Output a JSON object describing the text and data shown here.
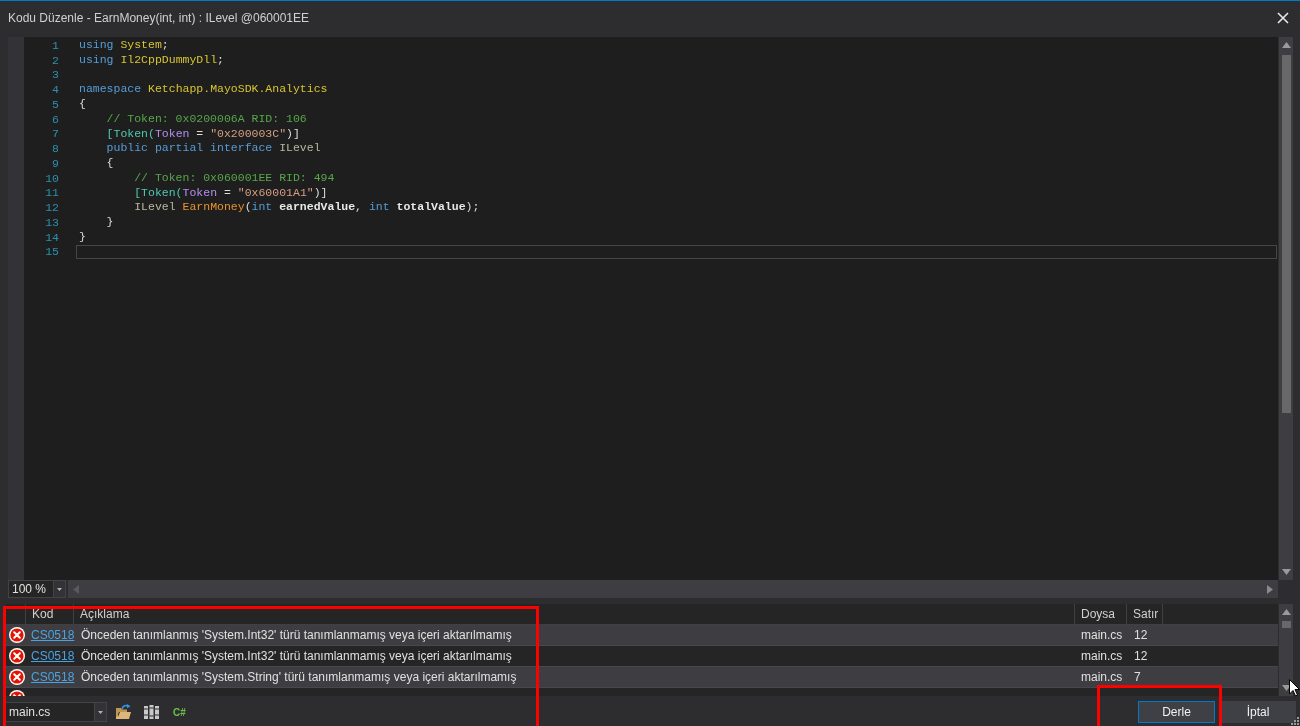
{
  "window": {
    "title": "Kodu Düzenle - EarnMoney(int, int) : ILevel @060001EE"
  },
  "editor": {
    "zoom": "100 %",
    "lines": [
      {
        "number": "1",
        "current": false,
        "tokens": [
          {
            "kind": "keyword",
            "text": "using"
          },
          {
            "kind": "namespace",
            "text": " System"
          },
          {
            "kind": "plain",
            "text": ";"
          }
        ]
      },
      {
        "number": "2",
        "current": false,
        "tokens": [
          {
            "kind": "keyword",
            "text": "using"
          },
          {
            "kind": "namespace",
            "text": " Il2CppDummyDll"
          },
          {
            "kind": "plain",
            "text": ";"
          }
        ]
      },
      {
        "number": "3",
        "current": false
      },
      {
        "number": "4",
        "current": false,
        "tokens": [
          {
            "kind": "keyword",
            "text": "namespace"
          },
          {
            "kind": "namespace",
            "text": " Ketchapp.MayoSDK.Analytics"
          }
        ]
      },
      {
        "number": "5",
        "current": false,
        "tokens": [
          {
            "kind": "plain",
            "text": "{"
          }
        ]
      },
      {
        "number": "6",
        "current": false,
        "tokens": [
          {
            "kind": "comment",
            "text": "    // Token: 0x0200006A RID: 106"
          }
        ]
      },
      {
        "number": "7",
        "current": false,
        "tokens": [
          {
            "kind": "attribute",
            "text": "    [Token("
          },
          {
            "kind": "property",
            "text": "Token"
          },
          {
            "kind": "plain",
            "text": " = "
          },
          {
            "kind": "string",
            "text": "\"0x200003C\""
          },
          {
            "kind": "plain",
            "text": ")]"
          }
        ]
      },
      {
        "number": "8",
        "current": false,
        "tokens": [
          {
            "kind": "keyword",
            "text": "    public partial interface"
          },
          {
            "kind": "type",
            "text": " ILevel"
          }
        ]
      },
      {
        "number": "9",
        "current": false,
        "tokens": [
          {
            "kind": "plain",
            "text": "    {"
          }
        ]
      },
      {
        "number": "10",
        "current": false,
        "tokens": [
          {
            "kind": "comment",
            "text": "        // Token: 0x060001EE RID: 494"
          }
        ]
      },
      {
        "number": "11",
        "current": false,
        "tokens": [
          {
            "kind": "attribute",
            "text": "        [Token("
          },
          {
            "kind": "property",
            "text": "Token"
          },
          {
            "kind": "plain",
            "text": " = "
          },
          {
            "kind": "string",
            "text": "\"0x60001A1\""
          },
          {
            "kind": "plain",
            "text": ")]"
          }
        ]
      },
      {
        "number": "12",
        "current": false,
        "tokens": [
          {
            "kind": "type",
            "text": "        ILevel"
          },
          {
            "kind": "method",
            "text": " EarnMoney"
          },
          {
            "kind": "plain",
            "text": "("
          },
          {
            "kind": "keyword",
            "text": "int"
          },
          {
            "kind": "parameter",
            "text": " earnedValue"
          },
          {
            "kind": "plain",
            "text": ", "
          },
          {
            "kind": "keyword",
            "text": "int"
          },
          {
            "kind": "parameter",
            "text": " totalValue"
          },
          {
            "kind": "plain",
            "text": ");"
          }
        ]
      },
      {
        "number": "13",
        "current": false,
        "tokens": [
          {
            "kind": "plain",
            "text": "    }"
          }
        ]
      },
      {
        "number": "14",
        "current": false,
        "tokens": [
          {
            "kind": "plain",
            "text": "}"
          }
        ]
      },
      {
        "number": "15",
        "current": true
      }
    ]
  },
  "error_list": {
    "columns": [
      "Kod",
      "Açıklama",
      "Doysa",
      "Satır"
    ],
    "rows": [
      {
        "kind": "error",
        "code": "CS0518",
        "description": "Önceden tanımlanmış 'System.Int32' türü tanımlanmamış veya içeri aktarılmamış",
        "file": "main.cs",
        "line": "12"
      },
      {
        "kind": "error",
        "code": "CS0518",
        "description": "Önceden tanımlanmış 'System.Int32' türü tanımlanmamış veya içeri aktarılmamış",
        "file": "main.cs",
        "line": "12"
      },
      {
        "kind": "error",
        "code": "CS0518",
        "description": "Önceden tanımlanmış 'System.String' türü tanımlanmamış veya içeri aktarılmamış",
        "file": "main.cs",
        "line": "7"
      },
      {
        "kind": "error"
      }
    ]
  },
  "footer": {
    "file": "main.cs",
    "language": "C#",
    "buttons": [
      {
        "label": "Derle",
        "default": true
      },
      {
        "label": "İptal",
        "default": false
      }
    ]
  }
}
